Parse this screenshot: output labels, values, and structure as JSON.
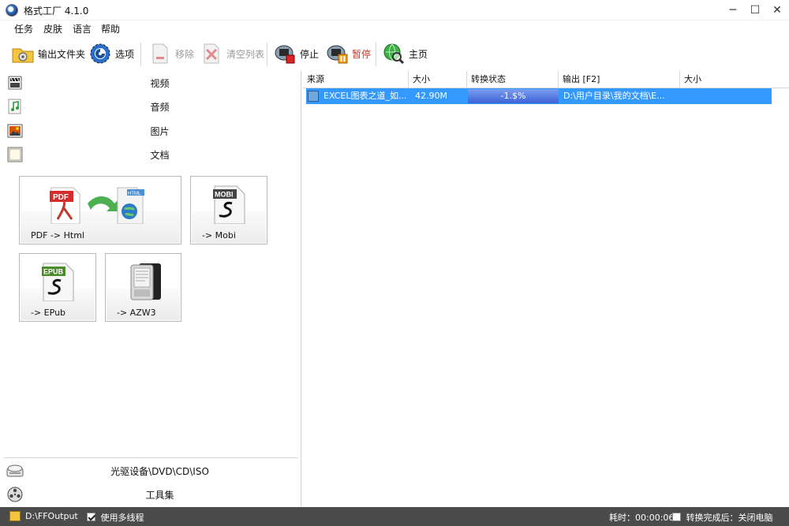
{
  "window": {
    "title": "格式工厂 4.1.0"
  },
  "menu": [
    "任务",
    "皮肤",
    "语言",
    "帮助"
  ],
  "toolbar": {
    "output_folder": "输出文件夹",
    "options": "选项",
    "remove": "移除",
    "clear_list": "清空列表",
    "stop": "停止",
    "pause": "暂停",
    "home": "主页"
  },
  "categories": {
    "video": "视频",
    "audio": "音频",
    "image": "图片",
    "document": "文档",
    "optical": "光驱设备\\DVD\\CD\\ISO",
    "tools": "工具集"
  },
  "doc_conversions": [
    {
      "label": "PDF -> Html",
      "icon": "pdf-to-html-icon",
      "badge1": "PDF",
      "badge2": "HTML"
    },
    {
      "label": "-> Mobi",
      "icon": "mobi-file-icon",
      "badge": "MOBI"
    },
    {
      "label": "-> EPub",
      "icon": "epub-file-icon",
      "badge": "EPUB"
    },
    {
      "label": "-> AZW3",
      "icon": "ereader-icon"
    }
  ],
  "task_table": {
    "headers": [
      "来源",
      "大小",
      "转换状态",
      "输出 [F2]",
      "大小"
    ],
    "rows": [
      {
        "source": "EXCEL图表之道_如...",
        "size": "42.90M",
        "status": "-1.$%",
        "output": "D:\\用户目录\\我的文档\\E...",
        "out_size": ""
      }
    ]
  },
  "status_bar": {
    "output_path": "D:\\FFOutput",
    "multithread": "使用多线程",
    "elapsed": "耗时：00:00:06",
    "after_convert": "转换完成后：关闭电脑"
  },
  "colors": {
    "selection": "#3399ff",
    "status_bar": "#4b4b4b",
    "progress": "#4a6fe0"
  }
}
